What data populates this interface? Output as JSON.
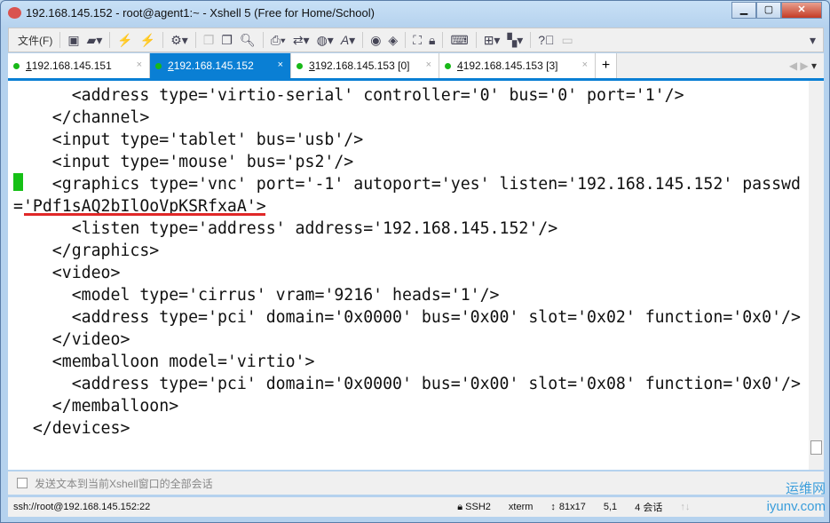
{
  "window": {
    "title": "192.168.145.152 - root@agent1:~ - Xshell 5 (Free for Home/School)",
    "minimize": "▁",
    "maximize": "▢",
    "close": "✕"
  },
  "toolbar": {
    "file_menu": "文件(F)",
    "icons": [
      "new-session-icon",
      "open-folder-icon",
      "connect-icon",
      "disconnect-icon",
      "properties-icon",
      "copy-icon",
      "paste-icon",
      "find-icon",
      "print-icon",
      "transfer-icon",
      "globe-icon",
      "font-icon",
      "xftp-icon",
      "xmanager-icon",
      "fullscreen-icon",
      "lock-icon",
      "keyboard-icon",
      "new-tab-icon",
      "layout-icon",
      "help-icon",
      "chat-icon"
    ]
  },
  "tabs": [
    {
      "num": "1",
      "label": " 192.168.145.151",
      "active": false
    },
    {
      "num": "2",
      "label": " 192.168.145.152",
      "active": true
    },
    {
      "num": "3",
      "label": " 192.168.145.153 [0]",
      "active": false
    },
    {
      "num": "4",
      "label": " 192.168.145.153 [3]",
      "active": false
    }
  ],
  "terminal": {
    "lines": [
      "      <address type='virtio-serial' controller='0' bus='0' port='1'/>",
      "    </channel>",
      "    <input type='tablet' bus='usb'/>",
      "    <input type='mouse' bus='ps2'/>",
      "    <graphics type='vnc' port='-1' autoport='yes' listen='192.168.145.152' passwd",
      "='Pdf1sAQ2bIlOoVpKSRfxaA'>",
      "      <listen type='address' address='192.168.145.152'/>",
      "    </graphics>",
      "    <video>",
      "      <model type='cirrus' vram='9216' heads='1'/>",
      "      <address type='pci' domain='0x0000' bus='0x00' slot='0x02' function='0x0'/>",
      "    </video>",
      "    <memballoon model='virtio'>",
      "      <address type='pci' domain='0x0000' bus='0x00' slot='0x08' function='0x0'/>",
      "    </memballoon>",
      "  </devices>",
      ""
    ],
    "cursor_color": "#16c016",
    "highlight_color": "#e02828"
  },
  "sendbar": {
    "label": "发送文本到当前Xshell窗口的全部会话"
  },
  "status": {
    "connection": "ssh://root@192.168.145.152:22",
    "protocol": "SSH2",
    "term": "xterm",
    "size": "81x17",
    "position": "5,1",
    "sessions": "4 会话"
  },
  "watermark": {
    "line1": "运维网",
    "line2": "iyunv.com"
  }
}
